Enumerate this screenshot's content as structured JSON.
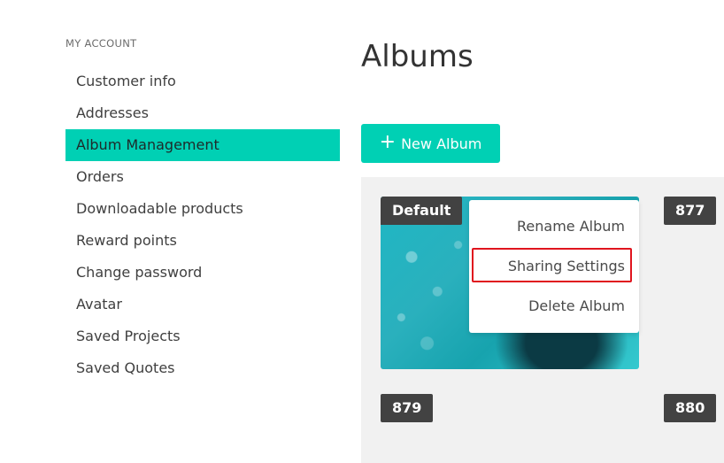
{
  "sidebar": {
    "heading": "MY ACCOUNT",
    "items": [
      {
        "label": "Customer info"
      },
      {
        "label": "Addresses"
      },
      {
        "label": "Album Management"
      },
      {
        "label": "Orders"
      },
      {
        "label": "Downloadable products"
      },
      {
        "label": "Reward points"
      },
      {
        "label": "Change password"
      },
      {
        "label": "Avatar"
      },
      {
        "label": "Saved Projects"
      },
      {
        "label": "Saved Quotes"
      }
    ],
    "active_item": "Album Management"
  },
  "main": {
    "title": "Albums",
    "new_album_button": {
      "icon": "plus-icon",
      "label": "New Album"
    },
    "albums": [
      {
        "badge": "Default"
      },
      {
        "badge": "877"
      },
      {
        "badge": "879"
      },
      {
        "badge": "880"
      }
    ],
    "context_menu": {
      "items": [
        "Rename Album",
        "Sharing Settings",
        "Delete Album"
      ],
      "highlighted": "Sharing Settings"
    }
  },
  "colors": {
    "accent": "#00d0b4",
    "badge_bg": "#424242",
    "highlight_border": "#e0141e",
    "panel_bg": "#f1f1f1"
  }
}
